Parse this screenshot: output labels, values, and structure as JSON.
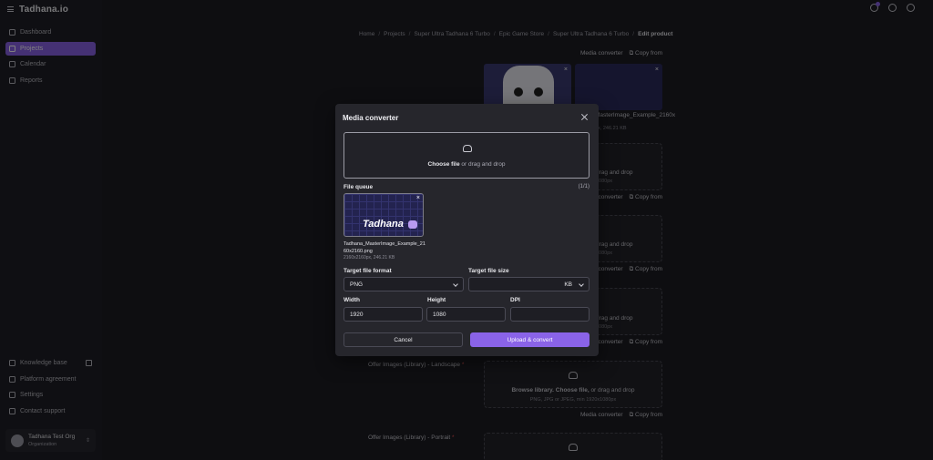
{
  "app": {
    "brand": "Tadhana.io"
  },
  "sidebar": {
    "items": [
      {
        "label": "Dashboard"
      },
      {
        "label": "Projects"
      },
      {
        "label": "Calendar"
      },
      {
        "label": "Reports"
      }
    ],
    "bottom_items": [
      {
        "label": "Knowledge base"
      },
      {
        "label": "Platform agreement"
      },
      {
        "label": "Settings"
      },
      {
        "label": "Contact support"
      }
    ],
    "org": {
      "name": "Tadhana Test Org",
      "role": "Organization"
    }
  },
  "breadcrumb": [
    "Home",
    "Projects",
    "Super Ultra Tadhana 6 Turbo",
    "Epic Game Store",
    "Super Ultra Tadhana 6 Turbo",
    "Edit product"
  ],
  "background": {
    "media_converter": "Media converter",
    "copy_from": "Copy from",
    "thumb_filename": "MasterImage_Example_2160x",
    "thumb_size": "px, 246.21 KB",
    "drag_drop": "drag and drop",
    "size_hint": "1080px",
    "landscape_label": "Offer Images (Library) - Landscape",
    "portrait_label": "Offer Images (Library) - Portrait",
    "required": "*",
    "browse_library": "Browse library.",
    "choose_file": "Choose file,",
    "or_drag_drop": "or drag and drop",
    "format_hint": "PNG, JPG or JPEG, min 1920x1080px"
  },
  "modal": {
    "title": "Media converter",
    "drop": {
      "choose_file": "Choose file",
      "or_text": "or drag and drop"
    },
    "queue": {
      "label": "File queue",
      "count": "(1/1)",
      "thumb_logo": "Tadhana",
      "file_name": "Tadhana_MasterImage_Example_2160x2160.png",
      "file_meta": "2160x2160px, 246.21 KB"
    },
    "format": {
      "label": "Target file format",
      "value": "PNG"
    },
    "size": {
      "label": "Target file size",
      "value": "",
      "unit": "KB"
    },
    "width": {
      "label": "Width",
      "value": "1920"
    },
    "height": {
      "label": "Height",
      "value": "1080"
    },
    "dpi": {
      "label": "DPI",
      "value": ""
    },
    "cancel_label": "Cancel",
    "submit_label": "Upload & convert"
  },
  "colors": {
    "accent": "#8a63e8",
    "background": "#1c1c22",
    "modal": "#26262c"
  }
}
